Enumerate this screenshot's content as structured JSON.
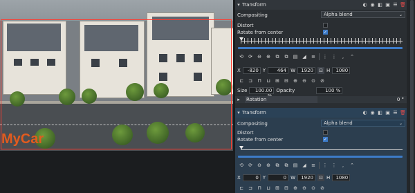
{
  "preview": {
    "watermark_text": "MyCar"
  },
  "effects": [
    {
      "title": "Transform",
      "compositing_label": "Compositing",
      "compositing_value": "Alpha blend",
      "distort_label": "Distort",
      "distort_checked": false,
      "rotate_label": "Rotate from center",
      "rotate_checked": true,
      "x_label": "X",
      "x_value": "-820",
      "y_label": "Y",
      "y_value": "464",
      "w_label": "W",
      "w_value": "1920",
      "h_label": "H",
      "h_value": "1080",
      "size_label": "Size",
      "size_value": "100.00 %",
      "opacity_label": "Opacity",
      "opacity_value": "100 %",
      "rotation_label": "Rotation",
      "rotation_value": "0 °"
    },
    {
      "title": "Transform",
      "compositing_label": "Compositing",
      "compositing_value": "Alpha blend",
      "distort_label": "Distort",
      "distort_checked": false,
      "rotate_label": "Rotate from center",
      "rotate_checked": true,
      "x_label": "X",
      "x_value": "0",
      "y_label": "Y",
      "y_value": "0",
      "w_label": "W",
      "w_value": "1920",
      "h_label": "H",
      "h_value": "1080"
    }
  ],
  "colors": {
    "accent": "#3d7bc8",
    "selected_panel": "#2c3e4f",
    "delete_icon": "#e04b4b",
    "watermark": "#e25b1f"
  }
}
